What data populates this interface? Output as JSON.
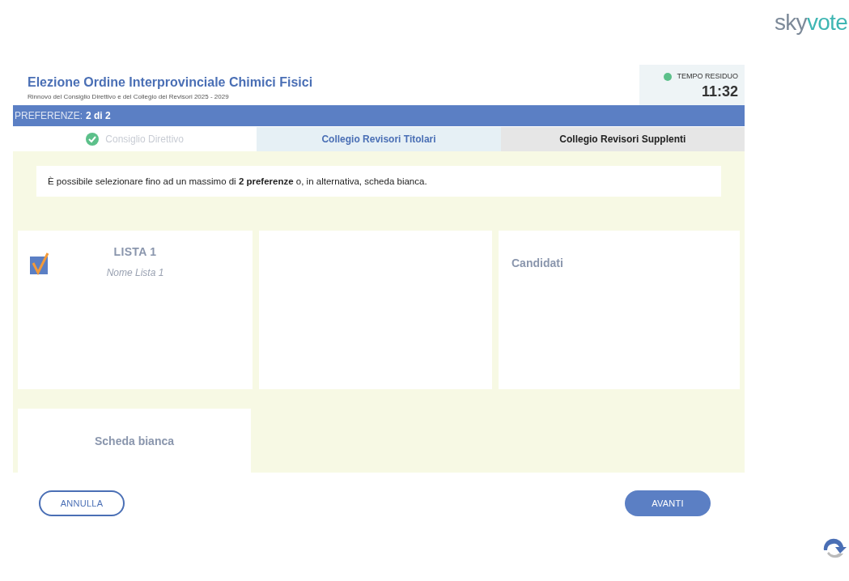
{
  "logo": {
    "part_1": "sky",
    "part_2": "vote"
  },
  "header": {
    "title": "Elezione Ordine Interprovinciale Chimici Fisici",
    "subtitle": "Rinnovo del Consiglio Direttivo e del Collegio dei Revisori 2025 - 2029"
  },
  "timer": {
    "label": "TEMPO RESIDUO",
    "value": "11:32"
  },
  "preferences_bar": {
    "label": "PREFERENZE:",
    "value": "2 di 2"
  },
  "tabs": [
    {
      "label": "Consiglio Direttivo",
      "completed": true,
      "selected": false
    },
    {
      "label": "Collegio Revisori Titolari",
      "completed": false,
      "selected": true
    },
    {
      "label": "Collegio Revisori Supplenti",
      "completed": false,
      "selected": false
    }
  ],
  "instruction": "È possibile selezionare fino ad un massimo di **2 preferenze** o, in alternativa, scheda bianca.",
  "lists": [
    {
      "title": "LISTA 1",
      "name": "Nome Lista 1",
      "checked": true
    }
  ],
  "candidates": {
    "title": "Candidati"
  },
  "blank_ballot": {
    "label": "Scheda bianca"
  },
  "buttons": {
    "cancel": "ANNULLA",
    "next": "AVANTI"
  }
}
